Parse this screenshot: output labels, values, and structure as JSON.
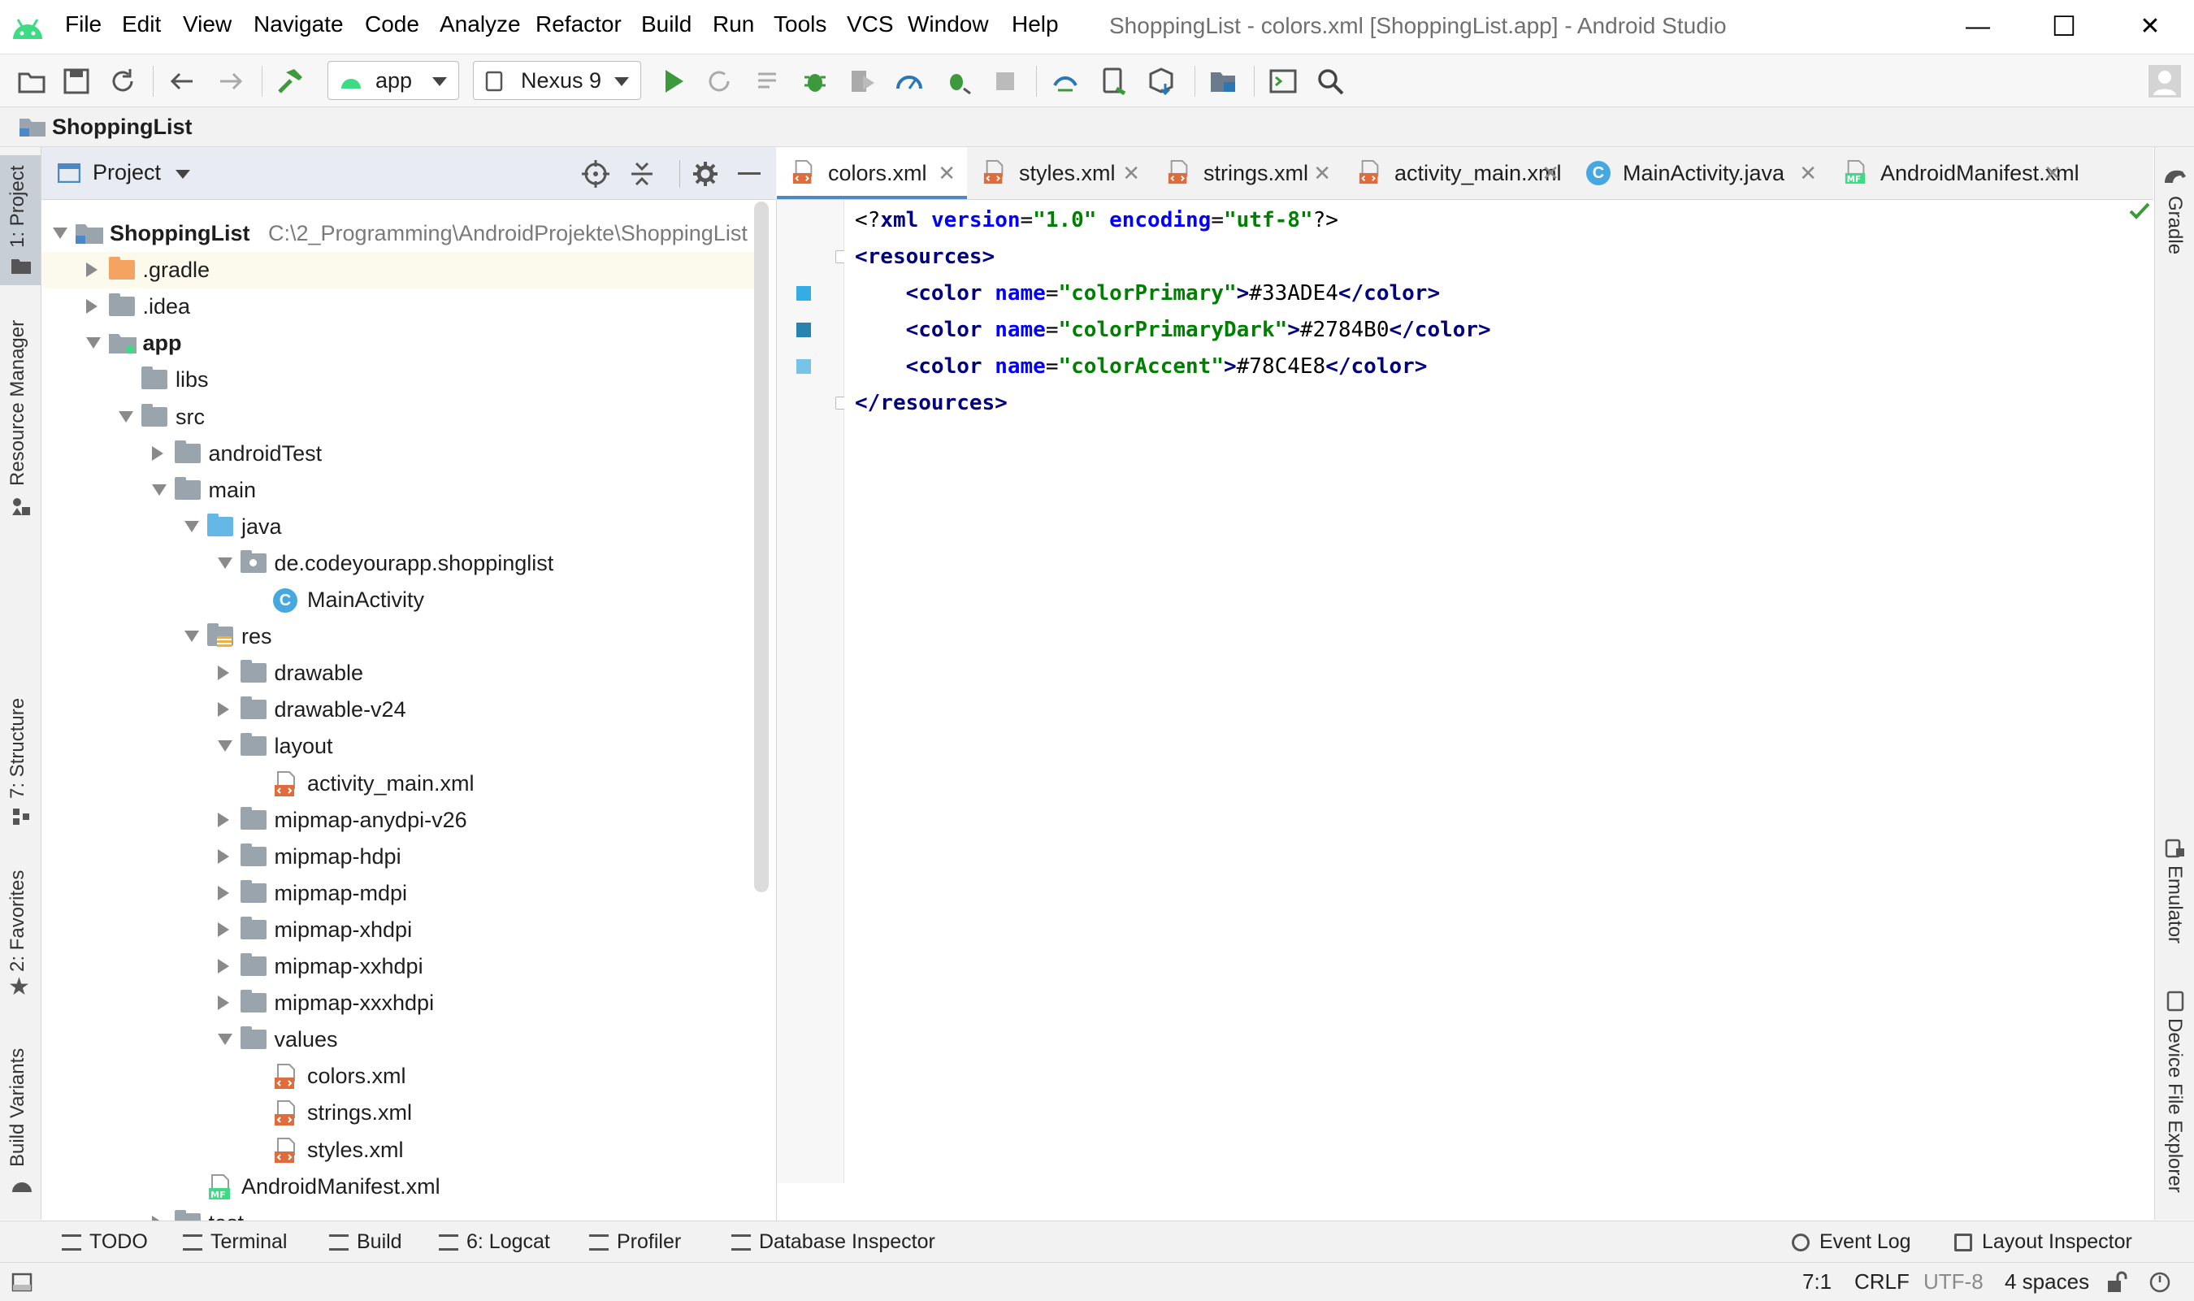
{
  "window": {
    "title": "ShoppingList - colors.xml [ShoppingList.app] - Android Studio",
    "minimize": "—",
    "maximize": "☐",
    "close": "✕"
  },
  "menu": [
    "File",
    "Edit",
    "View",
    "Navigate",
    "Code",
    "Analyze",
    "Refactor",
    "Build",
    "Run",
    "Tools",
    "VCS",
    "Window",
    "Help"
  ],
  "toolbar": {
    "run_config": "app",
    "device": "Nexus 9"
  },
  "breadcrumb": "ShoppingList",
  "left_strip": [
    "1: Project",
    "Resource Manager",
    "7: Structure",
    "2: Favorites",
    "Build Variants"
  ],
  "right_strip": [
    "Gradle",
    "Emulator",
    "Device File Explorer"
  ],
  "project_panel": {
    "title": "Project",
    "tree": [
      {
        "label": "ShoppingList",
        "path": "C:\\2_Programming\\AndroidProjekte\\ShoppingList",
        "depth": 0,
        "state": "open",
        "icon": "module"
      },
      {
        "label": ".gradle",
        "depth": 1,
        "state": "closed",
        "icon": "folder-orange"
      },
      {
        "label": ".idea",
        "depth": 1,
        "state": "closed",
        "icon": "folder"
      },
      {
        "label": "app",
        "depth": 1,
        "state": "open",
        "icon": "module"
      },
      {
        "label": "libs",
        "depth": 2,
        "state": "none",
        "icon": "folder"
      },
      {
        "label": "src",
        "depth": 2,
        "state": "open",
        "icon": "folder"
      },
      {
        "label": "androidTest",
        "depth": 3,
        "state": "closed",
        "icon": "folder"
      },
      {
        "label": "main",
        "depth": 3,
        "state": "open",
        "icon": "folder"
      },
      {
        "label": "java",
        "depth": 4,
        "state": "open",
        "icon": "folder-blue"
      },
      {
        "label": "de.codeyourapp.shoppinglist",
        "depth": 5,
        "state": "open",
        "icon": "package"
      },
      {
        "label": "MainActivity",
        "depth": 6,
        "state": "none",
        "icon": "class"
      },
      {
        "label": "res",
        "depth": 4,
        "state": "open",
        "icon": "res-folder"
      },
      {
        "label": "drawable",
        "depth": 5,
        "state": "closed",
        "icon": "folder"
      },
      {
        "label": "drawable-v24",
        "depth": 5,
        "state": "closed",
        "icon": "folder"
      },
      {
        "label": "layout",
        "depth": 5,
        "state": "open",
        "icon": "folder"
      },
      {
        "label": "activity_main.xml",
        "depth": 6,
        "state": "none",
        "icon": "xml"
      },
      {
        "label": "mipmap-anydpi-v26",
        "depth": 5,
        "state": "closed",
        "icon": "folder"
      },
      {
        "label": "mipmap-hdpi",
        "depth": 5,
        "state": "closed",
        "icon": "folder"
      },
      {
        "label": "mipmap-mdpi",
        "depth": 5,
        "state": "closed",
        "icon": "folder"
      },
      {
        "label": "mipmap-xhdpi",
        "depth": 5,
        "state": "closed",
        "icon": "folder"
      },
      {
        "label": "mipmap-xxhdpi",
        "depth": 5,
        "state": "closed",
        "icon": "folder"
      },
      {
        "label": "mipmap-xxxhdpi",
        "depth": 5,
        "state": "closed",
        "icon": "folder"
      },
      {
        "label": "values",
        "depth": 5,
        "state": "open",
        "icon": "folder"
      },
      {
        "label": "colors.xml",
        "depth": 6,
        "state": "none",
        "icon": "xml"
      },
      {
        "label": "strings.xml",
        "depth": 6,
        "state": "none",
        "icon": "xml"
      },
      {
        "label": "styles.xml",
        "depth": 6,
        "state": "none",
        "icon": "xml"
      },
      {
        "label": "AndroidManifest.xml",
        "depth": 4,
        "state": "none",
        "icon": "manifest"
      },
      {
        "label": "test",
        "depth": 3,
        "state": "closed",
        "icon": "folder"
      }
    ]
  },
  "tabs": [
    {
      "label": "colors.xml",
      "icon": "xml",
      "active": true
    },
    {
      "label": "styles.xml",
      "icon": "xml",
      "active": false
    },
    {
      "label": "strings.xml",
      "icon": "xml",
      "active": false
    },
    {
      "label": "activity_main.xml",
      "icon": "xml",
      "active": false
    },
    {
      "label": "MainActivity.java",
      "icon": "class",
      "active": false
    },
    {
      "label": "AndroidManifest.xml",
      "icon": "manifest",
      "active": false
    }
  ],
  "editor": {
    "lines": [
      [
        {
          "t": "plain",
          "v": "<?"
        },
        {
          "t": "tag",
          "v": "xml "
        },
        {
          "t": "attr",
          "v": "version"
        },
        {
          "t": "plain",
          "v": "="
        },
        {
          "t": "str",
          "v": "\"1.0\" "
        },
        {
          "t": "attr",
          "v": "encoding"
        },
        {
          "t": "plain",
          "v": "="
        },
        {
          "t": "str",
          "v": "\"utf-8\""
        },
        {
          "t": "plain",
          "v": "?>"
        }
      ],
      [
        {
          "t": "tag",
          "v": "<resources>"
        }
      ],
      [
        {
          "t": "plain",
          "v": "    "
        },
        {
          "t": "tag",
          "v": "<color "
        },
        {
          "t": "attr",
          "v": "name"
        },
        {
          "t": "plain",
          "v": "="
        },
        {
          "t": "str",
          "v": "\"colorPrimary\""
        },
        {
          "t": "tag",
          "v": ">"
        },
        {
          "t": "plain",
          "v": "#33ADE4"
        },
        {
          "t": "tag",
          "v": "</color>"
        }
      ],
      [
        {
          "t": "plain",
          "v": "    "
        },
        {
          "t": "tag",
          "v": "<color "
        },
        {
          "t": "attr",
          "v": "name"
        },
        {
          "t": "plain",
          "v": "="
        },
        {
          "t": "str",
          "v": "\"colorPrimaryDark\""
        },
        {
          "t": "tag",
          "v": ">"
        },
        {
          "t": "plain",
          "v": "#2784B0"
        },
        {
          "t": "tag",
          "v": "</color>"
        }
      ],
      [
        {
          "t": "plain",
          "v": "    "
        },
        {
          "t": "tag",
          "v": "<color "
        },
        {
          "t": "attr",
          "v": "name"
        },
        {
          "t": "plain",
          "v": "="
        },
        {
          "t": "str",
          "v": "\"colorAccent\""
        },
        {
          "t": "tag",
          "v": ">"
        },
        {
          "t": "plain",
          "v": "#78C4E8"
        },
        {
          "t": "tag",
          "v": "</color>"
        }
      ],
      [
        {
          "t": "tag",
          "v": "</resources>"
        }
      ],
      []
    ],
    "swatches": {
      "2": "#33ADE4",
      "3": "#2784B0",
      "4": "#78C4E8"
    }
  },
  "bottom_tools": [
    "TODO",
    "Terminal",
    "Build",
    "6: Logcat",
    "Profiler",
    "Database Inspector"
  ],
  "bottom_tools_right": [
    "Event Log",
    "Layout Inspector"
  ],
  "status": {
    "position": "7:1",
    "line_sep": "CRLF",
    "encoding": "UTF-8",
    "indent": "4 spaces"
  },
  "colors": {
    "accent": "#4a88c7",
    "android_green": "#3ddc84"
  }
}
